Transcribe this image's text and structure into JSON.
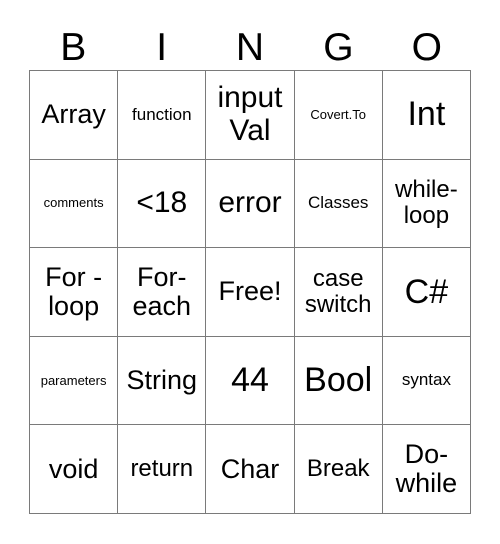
{
  "card": {
    "headers": [
      "B",
      "I",
      "N",
      "G",
      "O"
    ],
    "grid": [
      [
        {
          "text": "Array",
          "size": "fs-lg"
        },
        {
          "text": "function",
          "size": "fs-sm"
        },
        {
          "text": "input Val",
          "size": "fs-xl"
        },
        {
          "text": "Covert.To",
          "size": "fs-xs"
        },
        {
          "text": "Int",
          "size": "fs-xxl"
        }
      ],
      [
        {
          "text": "comments",
          "size": "fs-xs"
        },
        {
          "text": "<18",
          "size": "fs-xl"
        },
        {
          "text": "error",
          "size": "fs-xl"
        },
        {
          "text": "Classes",
          "size": "fs-sm"
        },
        {
          "text": "while-loop",
          "size": "fs-md"
        }
      ],
      [
        {
          "text": "For - loop",
          "size": "fs-lg"
        },
        {
          "text": "For-each",
          "size": "fs-lg"
        },
        {
          "text": "Free!",
          "size": "fs-lg"
        },
        {
          "text": "case switch",
          "size": "fs-md"
        },
        {
          "text": "C#",
          "size": "fs-xxl"
        }
      ],
      [
        {
          "text": "parameters",
          "size": "fs-xs"
        },
        {
          "text": "String",
          "size": "fs-lg"
        },
        {
          "text": "44",
          "size": "fs-xxl"
        },
        {
          "text": "Bool",
          "size": "fs-xxl"
        },
        {
          "text": "syntax",
          "size": "fs-sm"
        }
      ],
      [
        {
          "text": "void",
          "size": "fs-lg"
        },
        {
          "text": "return",
          "size": "fs-md"
        },
        {
          "text": "Char",
          "size": "fs-lg"
        },
        {
          "text": "Break",
          "size": "fs-md"
        },
        {
          "text": "Do-while",
          "size": "fs-lg"
        }
      ]
    ]
  }
}
